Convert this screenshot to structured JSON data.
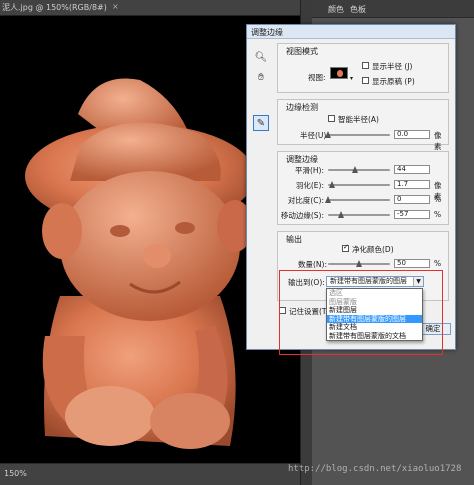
{
  "document": {
    "tab_title": "泥人.jpg @ 150%(RGB/8#)",
    "close": "×"
  },
  "panel_tabs": [
    "颜色",
    "色板"
  ],
  "status": {
    "zoom": "150%"
  },
  "watermark": "http://blog.csdn.net/xiaoluo1728",
  "dialog": {
    "title": "调整边缘",
    "view_mode": {
      "title": "视图模式",
      "view_label": "视图:",
      "show_radius": "显示半径 (J)",
      "show_original": "显示原稿 (P)",
      "show_radius_checked": false,
      "show_original_checked": false
    },
    "edge_detection": {
      "title": "边缘检测",
      "smart_radius": "智能半径(A)",
      "smart_radius_checked": false,
      "radius_label": "半径(U):",
      "radius_value": "0.0",
      "radius_unit": "像素",
      "radius_level": 0
    },
    "adjust_edge": {
      "title": "调整边缘",
      "rows": [
        {
          "label": "平滑(H):",
          "value": "44",
          "unit": "",
          "level": 0.44
        },
        {
          "label": "羽化(E):",
          "value": "1.7",
          "unit": "像素",
          "level": 0.07
        },
        {
          "label": "对比度(C):",
          "value": "0",
          "unit": "%",
          "level": 0
        },
        {
          "label": "移动边缘(S):",
          "value": "-57",
          "unit": "%",
          "level": 0.21
        }
      ]
    },
    "output": {
      "title": "输出",
      "decontaminate": "净化颜色(D)",
      "decontaminate_checked": true,
      "amount_label": "数量(N):",
      "amount_value": "50",
      "amount_unit": "%",
      "amount_level": 0.5,
      "output_to_label": "输出到(O):",
      "output_to_value": "新建带有图层蒙版的图层",
      "options": [
        "选区",
        "图层蒙版",
        "新建图层",
        "新建带有图层蒙版的图层",
        "新建文档",
        "新建带有图层蒙版的文档"
      ],
      "selected_index": 3
    },
    "remember_settings": "记住设置(T)",
    "remember_checked": false,
    "ok_button": "确定"
  },
  "colors": {
    "selection": "#3399ff",
    "highlight_box": "#e23030"
  }
}
